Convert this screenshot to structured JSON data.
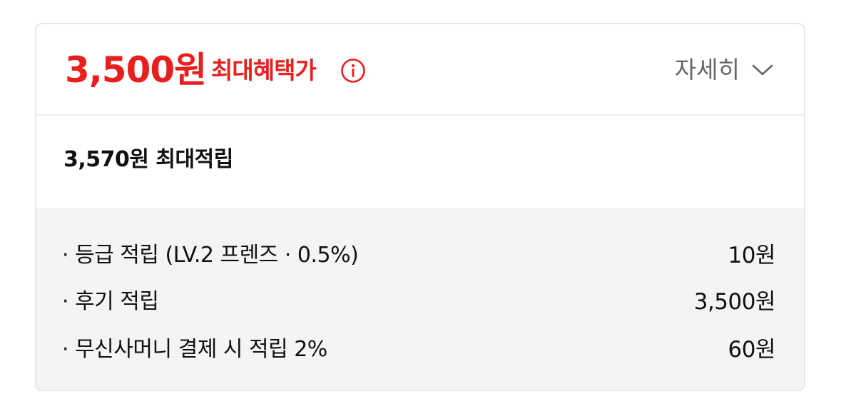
{
  "benefit": {
    "price": "3,500원",
    "price_label": "최대혜택가",
    "info_icon": "info-circle-icon",
    "detail_label": "자세히",
    "detail_icon": "chevron-down-icon",
    "accent_color": "#e8201d"
  },
  "accumulation": {
    "summary": "3,570원 최대적립",
    "items": [
      {
        "label": "· 등급 적립 (LV.2 프렌즈 · 0.5%)",
        "value": "10원"
      },
      {
        "label": "· 후기 적립",
        "value": "3,500원"
      },
      {
        "label": "· 무신사머니 결제 시 적립 2%",
        "value": "60원"
      }
    ]
  }
}
